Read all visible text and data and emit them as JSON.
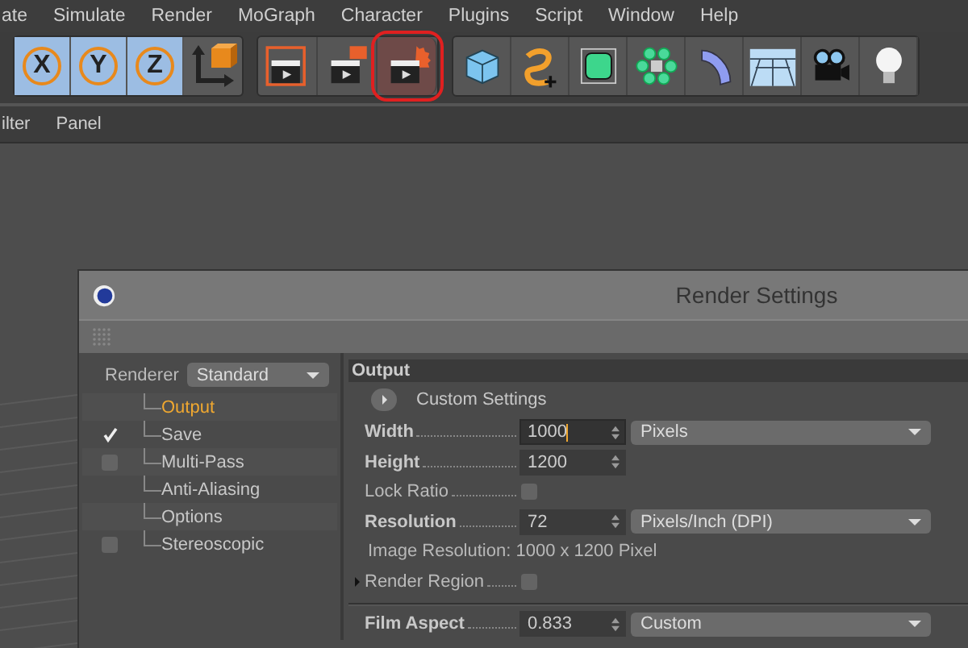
{
  "menu": [
    "ate",
    "Simulate",
    "Render",
    "MoGraph",
    "Character",
    "Plugins",
    "Script",
    "Window",
    "Help"
  ],
  "axis_buttons": [
    {
      "label": "X",
      "selected": true
    },
    {
      "label": "Y",
      "selected": true
    },
    {
      "label": "Z",
      "selected": true
    }
  ],
  "render_buttons": [
    {
      "kind": "render-view",
      "highlighted": false
    },
    {
      "kind": "render-picture",
      "highlighted": false
    },
    {
      "kind": "render-settings",
      "highlighted": true
    }
  ],
  "object_buttons": [
    {
      "kind": "cube"
    },
    {
      "kind": "spline"
    },
    {
      "kind": "subdivision"
    },
    {
      "kind": "cloner"
    },
    {
      "kind": "bend"
    },
    {
      "kind": "floor"
    },
    {
      "kind": "camera"
    },
    {
      "kind": "light"
    }
  ],
  "submenu": [
    "ilter",
    "Panel"
  ],
  "dialog": {
    "title": "Render Settings",
    "renderer_label": "Renderer",
    "renderer": "Standard",
    "tree": [
      {
        "label": "Output",
        "kind": "plain",
        "selected": true
      },
      {
        "label": "Save",
        "kind": "checkbox",
        "checked": true,
        "selected": false
      },
      {
        "label": "Multi-Pass",
        "kind": "checkbox",
        "checked": false,
        "selected": false
      },
      {
        "label": "Anti-Aliasing",
        "kind": "plain",
        "selected": false
      },
      {
        "label": "Options",
        "kind": "plain",
        "selected": false
      },
      {
        "label": "Stereoscopic",
        "kind": "checkbox",
        "checked": false,
        "selected": false
      }
    ],
    "section": "Output",
    "preset": "Custom Settings",
    "fields": [
      {
        "kind": "number",
        "label": "Width",
        "bold": true,
        "value": "1000",
        "focused": true,
        "unit": "Pixels"
      },
      {
        "kind": "number",
        "label": "Height",
        "bold": true,
        "value": "1200",
        "focused": false
      },
      {
        "kind": "checkbox",
        "label": "Lock Ratio",
        "bold": false,
        "checked": false
      },
      {
        "kind": "number",
        "label": "Resolution",
        "bold": true,
        "value": "72",
        "focused": false,
        "unit": "Pixels/Inch (DPI)"
      },
      {
        "kind": "info",
        "text": "Image Resolution: 1000 x 1200 Pixel"
      },
      {
        "kind": "checkbox",
        "label": "Render Region",
        "bold": false,
        "checked": false,
        "expander": true
      }
    ],
    "fields_2": [
      {
        "kind": "number",
        "label": "Film Aspect",
        "bold": true,
        "value": "0.833",
        "focused": false,
        "unit": "Custom"
      }
    ]
  }
}
